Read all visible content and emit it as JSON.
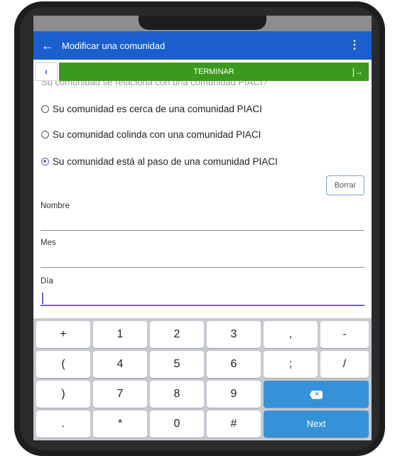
{
  "appbar": {
    "back_icon": "arrow-left-icon",
    "title": "Modificar una comunidad",
    "overflow_icon": "more-vertical-icon"
  },
  "action_row": {
    "prev_icon": "chevron-left-icon",
    "prev_glyph": "‹",
    "finish_label": "TERMINAR",
    "finish_icon": "exit-icon",
    "finish_glyph": "]→"
  },
  "form": {
    "question": "Su comunidad se relaciona con una comunidad PIACI?",
    "options": [
      {
        "label": "Su comunidad es cerca de una comunidad PIACI",
        "selected": false
      },
      {
        "label": "Su comunidad colinda con una comunidad PIACI",
        "selected": false
      },
      {
        "label": "Su comunidad está al paso de una comunidad PIACI",
        "selected": true
      }
    ],
    "clear_label": "Borrar",
    "fields": [
      {
        "label": "Nombre",
        "value": ""
      },
      {
        "label": "Mes",
        "value": ""
      },
      {
        "label": "Día",
        "value": ""
      }
    ]
  },
  "keyboard": {
    "rows": [
      [
        "+",
        "1",
        "2",
        "3",
        ",",
        "-"
      ],
      [
        "(",
        "4",
        "5",
        "6",
        ";",
        "/"
      ],
      [
        ")",
        "7",
        "8",
        "9"
      ],
      [
        ".",
        "*",
        "0",
        "#"
      ]
    ],
    "backspace_icon": "backspace-icon",
    "backspace_glyph": "✕",
    "next_label": "Next"
  },
  "colors": {
    "appbar": "#1b5fcf",
    "finish": "#3b9a1d",
    "accent": "#7b5cc7",
    "key_action": "#3592d8"
  }
}
